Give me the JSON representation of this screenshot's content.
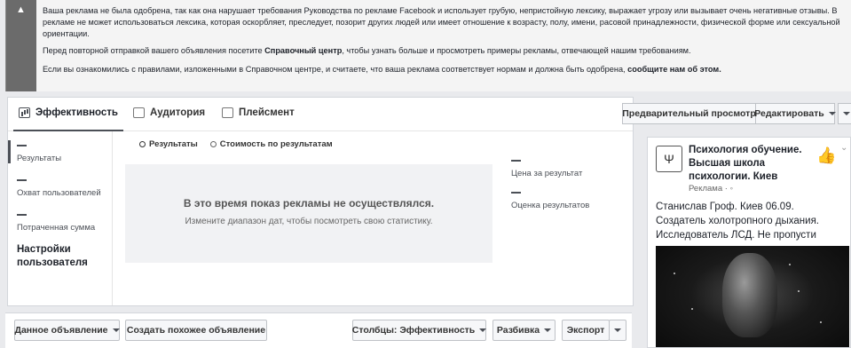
{
  "banner": {
    "warning_icon": "warning-triangle-icon",
    "p1": "Ваша реклама не была одобрена, так как она нарушает требования Руководства по рекламе Facebook и использует грубую, непристойную лексику, выражает угрозу или вызывает очень негативные отзывы. В рекламе не может использоваться лексика, которая оскорбляет, преследует, позорит других людей или имеет отношение к возрасту, полу, имени, расовой принадлежности, физической форме или сексуальной ориентации.",
    "p2_before": "Перед повторной отправкой вашего объявления посетите ",
    "p2_link": "Справочный центр",
    "p2_after": ", чтобы узнать больше и просмотреть примеры рекламы, отвечающей нашим требованиям.",
    "p3_before": "Если вы ознакомились с правилами, изложенными в Справочном центре, и считаете, что ваша реклама соответствует нормам и должна быть одобрена, ",
    "p3_link": "сообщите нам об этом."
  },
  "tabs": [
    {
      "label": "Эффективность",
      "icon": "bar-chart-icon"
    },
    {
      "label": "Аудитория",
      "icon": "people-icon"
    },
    {
      "label": "Плейсмент",
      "icon": "placement-icon"
    }
  ],
  "preview": {
    "preview_button": "Предварительный просмотр",
    "edit_button": "Редактировать"
  },
  "sidebar": {
    "items": [
      "Результаты",
      "Охват пользователей",
      "Потраченная сумма"
    ],
    "settings": "Настройки пользователя"
  },
  "radios": [
    "Результаты",
    "Стоимость по результатам"
  ],
  "empty": {
    "title": "В это время показ рекламы не осуществлялся.",
    "subtitle": "Измените диапазон дат, чтобы посмотреть свою статистику."
  },
  "metrics": [
    "Цена за результат",
    "Оценка результатов"
  ],
  "bottom": {
    "ad_select": "Данное объявление",
    "create_similar": "Создать похожее объявление",
    "columns": "Столбцы: Эффективность",
    "breakdown": "Разбивка",
    "export": "Экспорт"
  },
  "ad": {
    "page_name": "Психология обучение. Высшая школа психологии. Киев",
    "sponsored": "Реклама · ",
    "text": "Станислав Гроф. Киев 06.09. Создатель холотропного дыхания. Исследователь ЛСД. Не пропусти",
    "logo_icon": "school-logo-icon",
    "like_icon": "thumbs-up-icon"
  },
  "colors": {
    "banner_bg": "#6b6b6b",
    "panel_bg": "#ffffff",
    "page_bg": "#e9eaed"
  }
}
